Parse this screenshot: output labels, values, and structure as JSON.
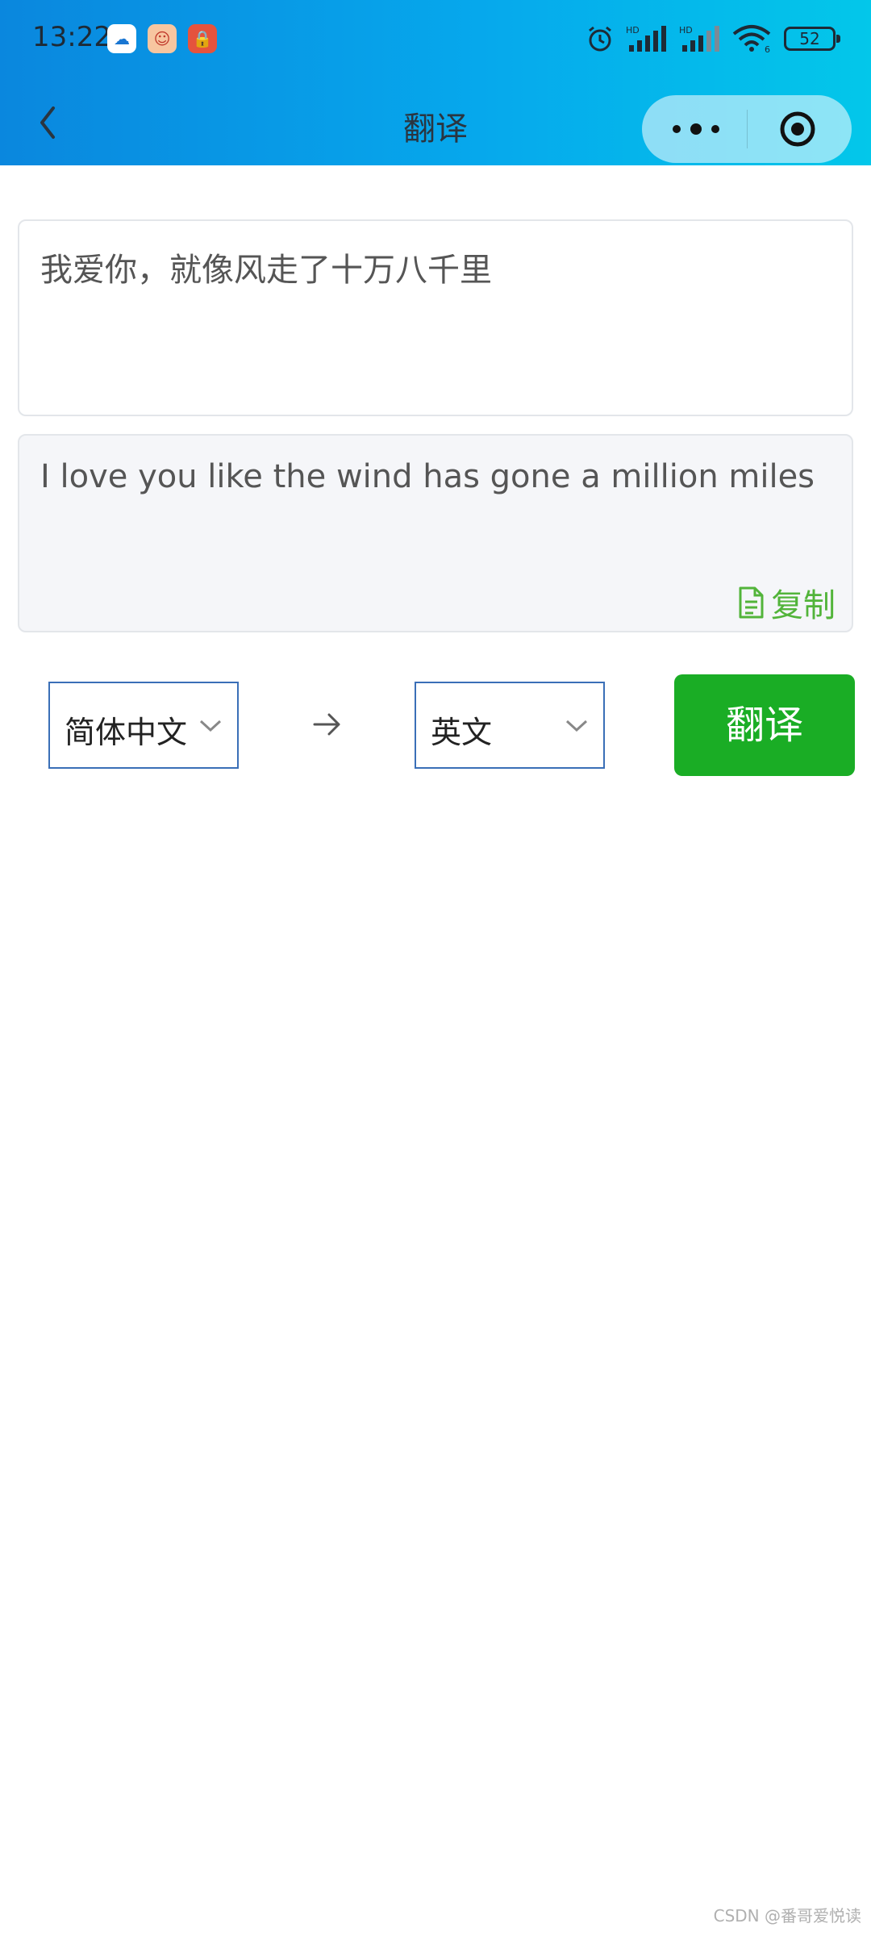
{
  "status_bar": {
    "time": "13:22",
    "battery": "52",
    "signal_label_1": "HD",
    "signal_label_2": "HD",
    "wifi_sub": "6"
  },
  "nav": {
    "title": "翻译"
  },
  "input": {
    "value": "我爱你，就像风走了十万八千里"
  },
  "output": {
    "value": "I love you like the wind has gone a million miles",
    "copy_label": "复制"
  },
  "controls": {
    "from_language": "简体中文",
    "to_language": "英文",
    "translate_label": "翻译"
  },
  "watermark": "CSDN @番哥爱悦读",
  "colors": {
    "accent_green": "#1aad25",
    "copy_green": "#52b43a",
    "select_border": "#3a6fb7",
    "header_start": "#0a87de",
    "header_end": "#03c7ea"
  }
}
